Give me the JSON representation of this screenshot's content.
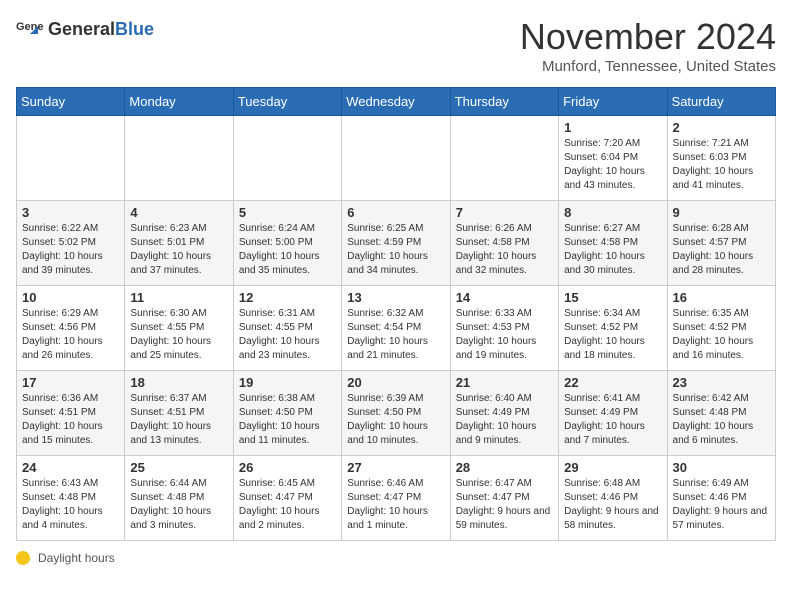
{
  "header": {
    "logo_general": "General",
    "logo_blue": "Blue",
    "month_title": "November 2024",
    "location": "Munford, Tennessee, United States"
  },
  "legend": {
    "daylight_label": "Daylight hours"
  },
  "weekdays": [
    "Sunday",
    "Monday",
    "Tuesday",
    "Wednesday",
    "Thursday",
    "Friday",
    "Saturday"
  ],
  "weeks": [
    [
      {
        "day": "",
        "info": ""
      },
      {
        "day": "",
        "info": ""
      },
      {
        "day": "",
        "info": ""
      },
      {
        "day": "",
        "info": ""
      },
      {
        "day": "",
        "info": ""
      },
      {
        "day": "1",
        "info": "Sunrise: 7:20 AM\nSunset: 6:04 PM\nDaylight: 10 hours and 43 minutes."
      },
      {
        "day": "2",
        "info": "Sunrise: 7:21 AM\nSunset: 6:03 PM\nDaylight: 10 hours and 41 minutes."
      }
    ],
    [
      {
        "day": "3",
        "info": "Sunrise: 6:22 AM\nSunset: 5:02 PM\nDaylight: 10 hours and 39 minutes."
      },
      {
        "day": "4",
        "info": "Sunrise: 6:23 AM\nSunset: 5:01 PM\nDaylight: 10 hours and 37 minutes."
      },
      {
        "day": "5",
        "info": "Sunrise: 6:24 AM\nSunset: 5:00 PM\nDaylight: 10 hours and 35 minutes."
      },
      {
        "day": "6",
        "info": "Sunrise: 6:25 AM\nSunset: 4:59 PM\nDaylight: 10 hours and 34 minutes."
      },
      {
        "day": "7",
        "info": "Sunrise: 6:26 AM\nSunset: 4:58 PM\nDaylight: 10 hours and 32 minutes."
      },
      {
        "day": "8",
        "info": "Sunrise: 6:27 AM\nSunset: 4:58 PM\nDaylight: 10 hours and 30 minutes."
      },
      {
        "day": "9",
        "info": "Sunrise: 6:28 AM\nSunset: 4:57 PM\nDaylight: 10 hours and 28 minutes."
      }
    ],
    [
      {
        "day": "10",
        "info": "Sunrise: 6:29 AM\nSunset: 4:56 PM\nDaylight: 10 hours and 26 minutes."
      },
      {
        "day": "11",
        "info": "Sunrise: 6:30 AM\nSunset: 4:55 PM\nDaylight: 10 hours and 25 minutes."
      },
      {
        "day": "12",
        "info": "Sunrise: 6:31 AM\nSunset: 4:55 PM\nDaylight: 10 hours and 23 minutes."
      },
      {
        "day": "13",
        "info": "Sunrise: 6:32 AM\nSunset: 4:54 PM\nDaylight: 10 hours and 21 minutes."
      },
      {
        "day": "14",
        "info": "Sunrise: 6:33 AM\nSunset: 4:53 PM\nDaylight: 10 hours and 19 minutes."
      },
      {
        "day": "15",
        "info": "Sunrise: 6:34 AM\nSunset: 4:52 PM\nDaylight: 10 hours and 18 minutes."
      },
      {
        "day": "16",
        "info": "Sunrise: 6:35 AM\nSunset: 4:52 PM\nDaylight: 10 hours and 16 minutes."
      }
    ],
    [
      {
        "day": "17",
        "info": "Sunrise: 6:36 AM\nSunset: 4:51 PM\nDaylight: 10 hours and 15 minutes."
      },
      {
        "day": "18",
        "info": "Sunrise: 6:37 AM\nSunset: 4:51 PM\nDaylight: 10 hours and 13 minutes."
      },
      {
        "day": "19",
        "info": "Sunrise: 6:38 AM\nSunset: 4:50 PM\nDaylight: 10 hours and 11 minutes."
      },
      {
        "day": "20",
        "info": "Sunrise: 6:39 AM\nSunset: 4:50 PM\nDaylight: 10 hours and 10 minutes."
      },
      {
        "day": "21",
        "info": "Sunrise: 6:40 AM\nSunset: 4:49 PM\nDaylight: 10 hours and 9 minutes."
      },
      {
        "day": "22",
        "info": "Sunrise: 6:41 AM\nSunset: 4:49 PM\nDaylight: 10 hours and 7 minutes."
      },
      {
        "day": "23",
        "info": "Sunrise: 6:42 AM\nSunset: 4:48 PM\nDaylight: 10 hours and 6 minutes."
      }
    ],
    [
      {
        "day": "24",
        "info": "Sunrise: 6:43 AM\nSunset: 4:48 PM\nDaylight: 10 hours and 4 minutes."
      },
      {
        "day": "25",
        "info": "Sunrise: 6:44 AM\nSunset: 4:48 PM\nDaylight: 10 hours and 3 minutes."
      },
      {
        "day": "26",
        "info": "Sunrise: 6:45 AM\nSunset: 4:47 PM\nDaylight: 10 hours and 2 minutes."
      },
      {
        "day": "27",
        "info": "Sunrise: 6:46 AM\nSunset: 4:47 PM\nDaylight: 10 hours and 1 minute."
      },
      {
        "day": "28",
        "info": "Sunrise: 6:47 AM\nSunset: 4:47 PM\nDaylight: 9 hours and 59 minutes."
      },
      {
        "day": "29",
        "info": "Sunrise: 6:48 AM\nSunset: 4:46 PM\nDaylight: 9 hours and 58 minutes."
      },
      {
        "day": "30",
        "info": "Sunrise: 6:49 AM\nSunset: 4:46 PM\nDaylight: 9 hours and 57 minutes."
      }
    ]
  ]
}
